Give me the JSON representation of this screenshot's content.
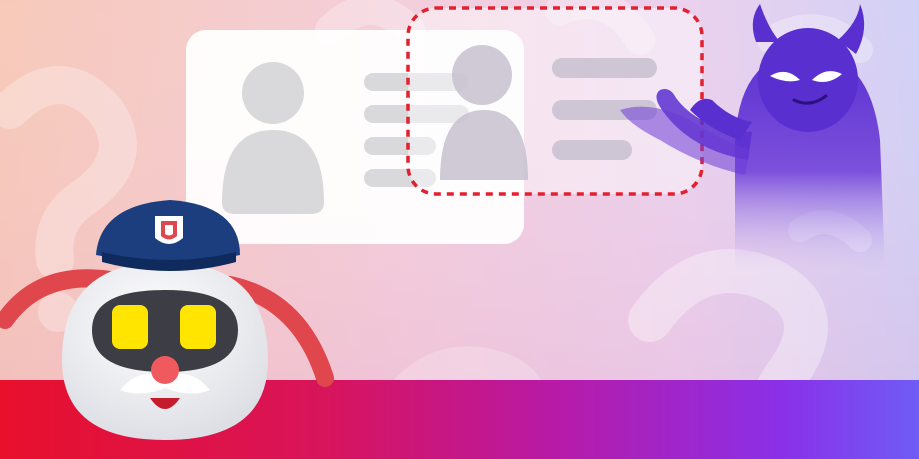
{
  "scene": {
    "description_icon": "identity-theft-illustration",
    "colors": {
      "bg_left": "#f6c0ad",
      "bg_mid": "#ecc8e3",
      "bg_right": "#c9c9f5",
      "bottom_band_left": "#e8102c",
      "bottom_band_mid": "#c4149a",
      "bottom_band_right": "#6f5cf6",
      "villain": "#5a2fd0",
      "selection_dash": "#e3202f",
      "robot_cap": "#1c3e7e",
      "robot_eyes": "#ffe500",
      "robot_antenna": "#e0474c"
    },
    "elements": {
      "id_card": "id-card-icon",
      "copied_card": "copied-id-selection",
      "villain": "devil-villain-icon",
      "robot": "police-robot-mascot",
      "badge": "shield-badge-icon"
    }
  }
}
